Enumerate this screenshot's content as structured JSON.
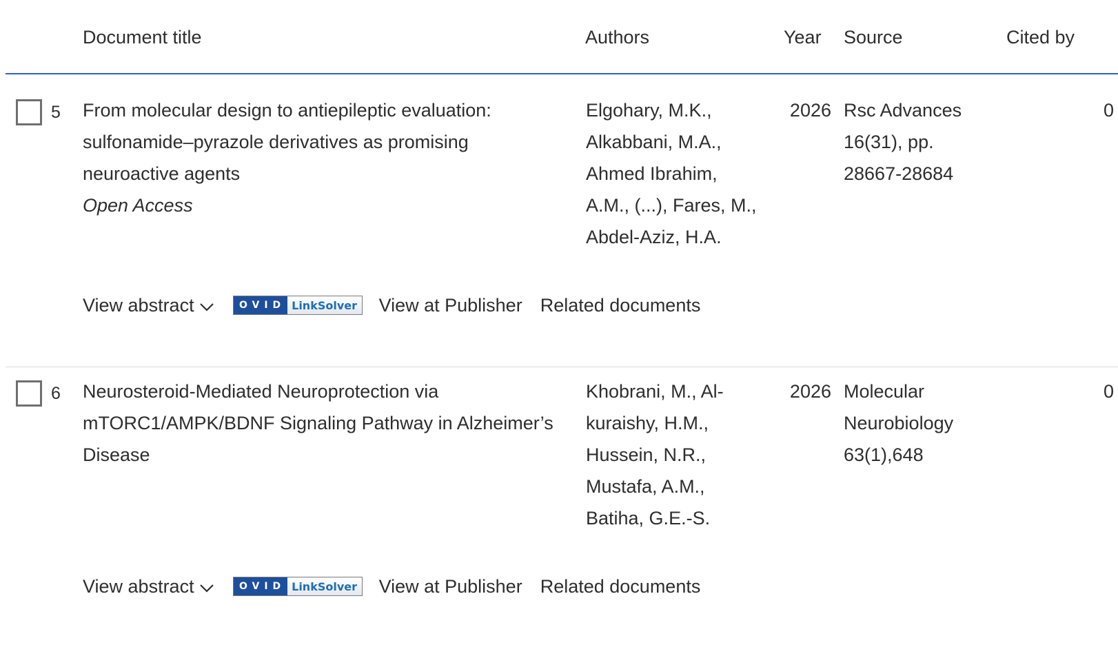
{
  "header": {
    "title": "Document title",
    "authors": "Authors",
    "year": "Year",
    "source": "Source",
    "cited_by": "Cited by"
  },
  "colors": {
    "accent_line": "#2b5fd9",
    "ovid_dark": "#1d4f9c",
    "ovid_link": "#1d6fb8"
  },
  "rows": [
    {
      "number": "5",
      "title_lines": [
        "From molecular design to antiepileptic evaluation:",
        "sulfonamide–pyrazole derivatives as promising",
        "neuroactive agents"
      ],
      "access": "Open Access",
      "author_lines": [
        "Elgohary, M.K.,",
        "Alkabbani, M.A.,",
        "Ahmed Ibrahim,",
        "A.M., (...), Fares, M.,",
        "Abdel-Aziz, H.A."
      ],
      "year": "2026",
      "source_lines": [
        "Rsc Advances",
        "16(31), pp.",
        "28667-28684"
      ],
      "cited_by": "0",
      "actions": {
        "view_abstract": "View abstract",
        "ovid_left": "OVID",
        "ovid_right": "LinkSolver",
        "view_publisher": "View at Publisher",
        "related": "Related documents"
      }
    },
    {
      "number": "6",
      "title_lines": [
        "Neurosteroid-Mediated Neuroprotection via",
        "mTORC1/AMPK/BDNF Signaling Pathway in Alzheimer’s",
        "Disease"
      ],
      "author_lines": [
        "Khobrani, M., Al-",
        "kuraishy, H.M.,",
        "Hussein, N.R.,",
        "Mustafa, A.M.,",
        "Batiha, G.E.-S."
      ],
      "year": "2026",
      "source_lines": [
        "Molecular",
        "Neurobiology",
        "63(1),648"
      ],
      "cited_by": "0",
      "actions": {
        "view_abstract": "View abstract",
        "ovid_left": "OVID",
        "ovid_right": "LinkSolver",
        "view_publisher": "View at Publisher",
        "related": "Related documents"
      }
    }
  ]
}
